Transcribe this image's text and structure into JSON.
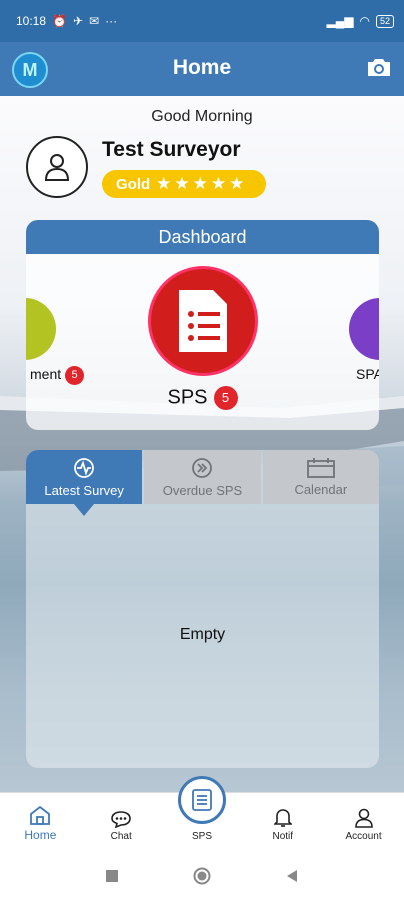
{
  "status_bar": {
    "time": "10:18",
    "battery": "52"
  },
  "app_bar": {
    "title": "Home"
  },
  "profile": {
    "greeting": "Good Morning",
    "name": "Test Surveyor",
    "tier": "Gold",
    "stars": "★★★★★"
  },
  "dashboard": {
    "title": "Dashboard",
    "left_item": {
      "label": "ment",
      "badge": "5"
    },
    "main_item": {
      "label": "SPS",
      "badge": "5"
    },
    "right_item": {
      "label": "SPA"
    }
  },
  "tabs": {
    "items": [
      {
        "label": "Latest Survey",
        "icon": "activity-icon",
        "active": true
      },
      {
        "label": "Overdue SPS",
        "icon": "double-chevron-icon",
        "active": false
      },
      {
        "label": "Calendar",
        "icon": "calendar-icon",
        "active": false
      }
    ],
    "empty_text": "Empty"
  },
  "bottom_nav": {
    "items": [
      {
        "label": "Home",
        "icon": "home-icon",
        "active": true
      },
      {
        "label": "Chat",
        "icon": "chat-icon"
      },
      {
        "label": "SPS",
        "icon": "document-icon"
      },
      {
        "label": "Notif",
        "icon": "bell-icon"
      },
      {
        "label": "Account",
        "icon": "account-icon"
      }
    ]
  },
  "colors": {
    "primary": "#3f7ab6",
    "badge": "#e0262b",
    "gold": "#f7c600",
    "sps_red": "#d21d1d"
  }
}
